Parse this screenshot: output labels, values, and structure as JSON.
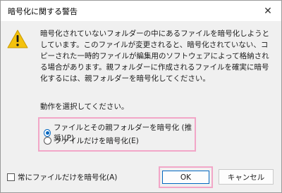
{
  "dialog": {
    "title": "暗号化に関する警告",
    "close_symbol": "✕",
    "icon": "warning-icon",
    "message": "暗号化されていないフォルダーの中にあるファイルを暗号化しようとしています。このファイルが変更されると、暗号化されていない、コピーされた一時的ファイルが編集用のソフトウェアによって格納される場合があります。親フォルダーに作成されるファイルを確実に暗号化するには、親フォルダーを暗号化してください。",
    "prompt": "動作を選択してください。",
    "options": [
      {
        "label": "ファイルとその親フォルダーを暗号化 (推奨)(P)",
        "checked": true
      },
      {
        "label": "ファイルだけを暗号化(E)",
        "checked": false
      }
    ],
    "always_checkbox": {
      "label": "常にファイルだけを暗号化(A)",
      "checked": false
    },
    "ok_label": "OK",
    "cancel_label": "キャンセル",
    "colors": {
      "accent": "#0067c0",
      "highlight": "#f2a6c7",
      "warning": "#f4c20d"
    }
  }
}
